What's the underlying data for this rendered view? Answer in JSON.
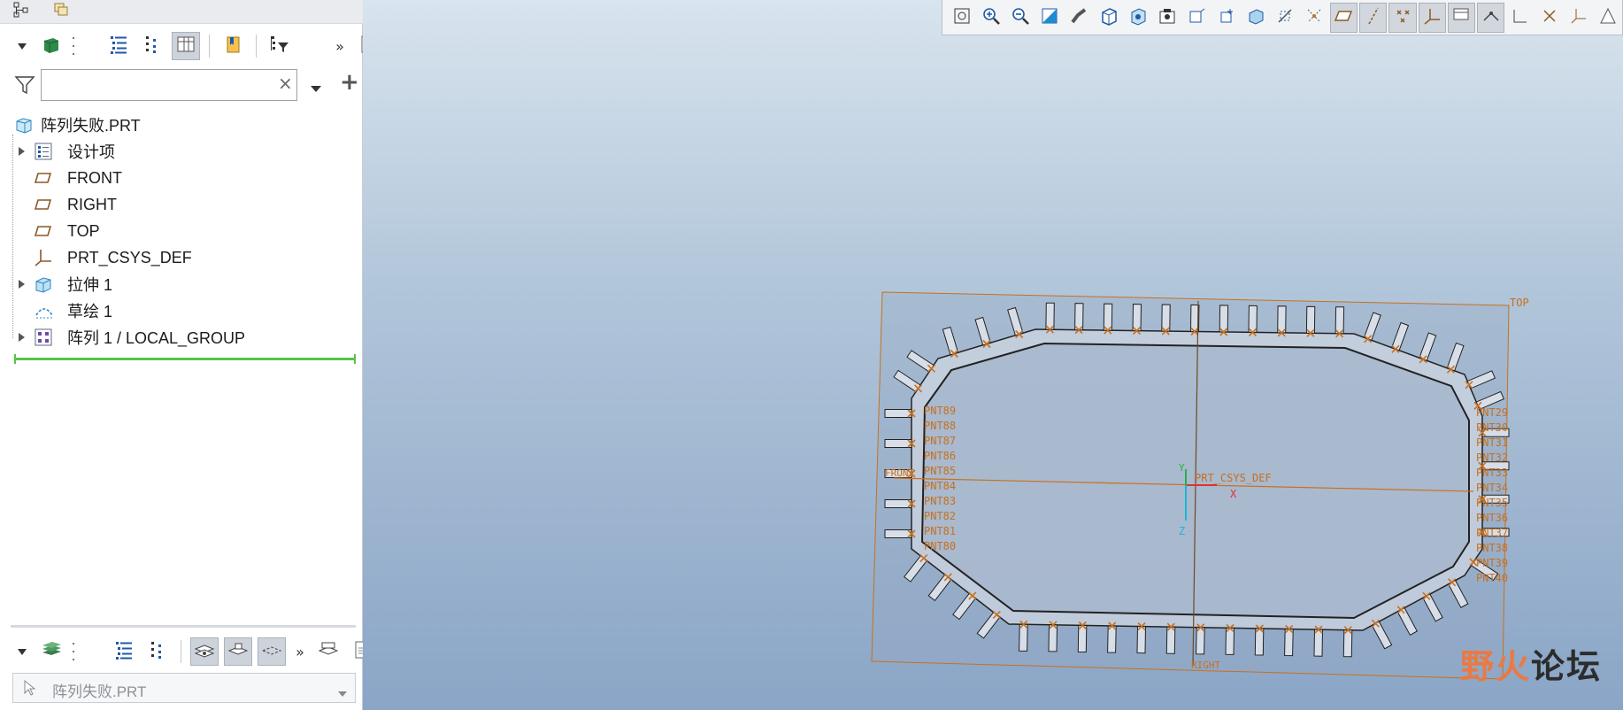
{
  "colors": {
    "accent_green": "#58c24a",
    "model_orange": "#c8701e",
    "csys_red": "#e23030",
    "csys_green": "#25b04a",
    "csys_cyan": "#19b8d6",
    "viewport_top": "#d8e4ee",
    "viewport_bottom": "#8aa5c6"
  },
  "left_panel": {
    "top_tabs": [
      {
        "icon": "model-tree-tab-icon"
      },
      {
        "icon": "layers-tab-icon"
      }
    ],
    "toolbar": {
      "items": [
        "model-cube-icon",
        "list-tree-icon",
        "tree-columns-icon",
        "tree-settings-icon",
        "bookmark-icon",
        "tree-filter-icon",
        "overflow-chevron-icon",
        "notes-icon"
      ],
      "overflow": "»"
    },
    "filter": {
      "value": "",
      "clear": "×",
      "add": "+"
    },
    "tree": {
      "root": "阵列失败.PRT",
      "items": [
        {
          "label": "设计项",
          "icon": "design-items-icon",
          "expandable": true
        },
        {
          "label": "FRONT",
          "icon": "datum-plane-icon",
          "expandable": false
        },
        {
          "label": "RIGHT",
          "icon": "datum-plane-icon",
          "expandable": false
        },
        {
          "label": "TOP",
          "icon": "datum-plane-icon",
          "expandable": false
        },
        {
          "label": "PRT_CSYS_DEF",
          "icon": "csys-icon",
          "expandable": false
        },
        {
          "label": "拉伸 1",
          "icon": "extrude-icon",
          "expandable": true
        },
        {
          "label": "草绘 1",
          "icon": "sketch-icon",
          "expandable": false
        },
        {
          "label": "阵列 1 / LOCAL_GROUP",
          "icon": "pattern-icon",
          "expandable": true
        }
      ]
    },
    "layers": {
      "overflow": "»",
      "select_value": "阵列失败.PRT"
    }
  },
  "viewport": {
    "toolbar_icons": [
      "refit-icon",
      "zoom-in-icon",
      "zoom-out-icon",
      "repaint-icon",
      "perspective-icon",
      "display-style-icon",
      "saved-orientation-icon",
      "named-views-icon",
      "view-manager-icon",
      "spin-center-icon",
      "section-icon",
      "appearance-icon",
      "annotation-display-icon",
      "datum-planes-icon",
      "datum-axes-icon",
      "point-display-icon",
      "csys-display-icon",
      "model-tree-display-icon",
      "plane-tag-icon",
      "axis-tag-icon",
      "point-tag-icon",
      "csys-tag-icon",
      "simplified-rep-icon"
    ],
    "labels": {
      "top_plane": "TOP",
      "front_plane": "FRONT",
      "right_plane": "RIGHT",
      "csys": "PRT_CSYS_DEF",
      "axis_x": "X",
      "axis_y": "Y",
      "axis_z": "Z"
    },
    "point_labels_left": [
      "PNT89",
      "PNT88",
      "PNT87",
      "PNT86",
      "PNT85",
      "PNT84",
      "PNT83",
      "PNT82",
      "PNT81",
      "PNT80"
    ],
    "point_labels_right": [
      "PNT29",
      "PNT30",
      "PNT31",
      "PNT32",
      "PNT33",
      "PNT34",
      "PNT35",
      "PNT36",
      "PNT37",
      "PNT38",
      "PNT39",
      "PNT40"
    ]
  },
  "watermark": {
    "part1": "野火",
    "part2": "论坛"
  }
}
